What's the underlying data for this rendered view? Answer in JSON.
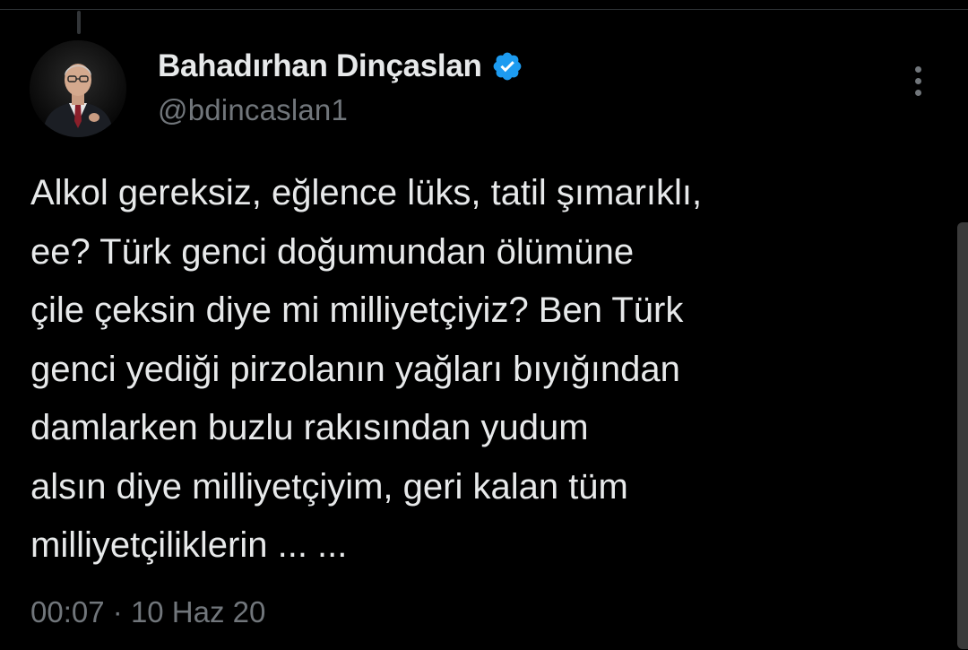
{
  "tweet": {
    "author": {
      "display_name": "Bahadırhan Dinçaslan",
      "handle": "@bdincaslan1",
      "verified": true,
      "verified_badge_color": "#1d9bf0",
      "avatar_icon": "profile-photo"
    },
    "text_lines": [
      "Alkol gereksiz, eğlence lüks, tatil şımarıklı,",
      "ee? Türk genci doğumundan ölümüne",
      "çile çeksin diye mi milliyetçiyiz? Ben Türk",
      "genci yediği pirzolanın yağları bıyığından",
      "damlarken buzlu rakısından yudum",
      "alsın diye milliyetçiyim, geri kalan tüm",
      "milliyetçiliklerin ... ..."
    ],
    "time": "00:07",
    "separator": "·",
    "date": "10 Haz 20",
    "more_icon": "more-vertical-icon"
  },
  "theme": {
    "background": "#000000",
    "primary_text": "#e7e9ea",
    "secondary_text": "#71767b"
  }
}
